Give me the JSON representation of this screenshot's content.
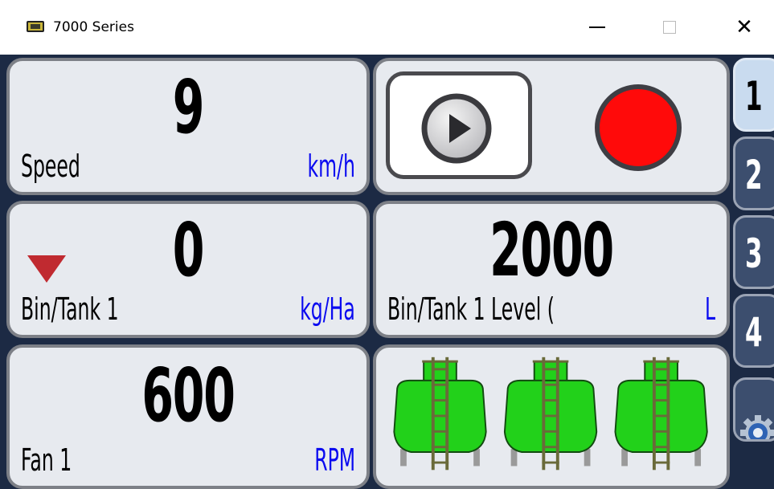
{
  "window": {
    "title": "7000 Series",
    "close_glyph": "✕"
  },
  "tiles": {
    "speed": {
      "value": "9",
      "label": "Speed",
      "unit": "km/h"
    },
    "bin_rate": {
      "value": "0",
      "label": "Bin/Tank 1",
      "unit": "kg/Ha",
      "indicator": "down-arrow-icon"
    },
    "fan": {
      "value": "600",
      "label": "Fan 1",
      "unit": "RPM"
    },
    "bin_level": {
      "value": "2000",
      "label": "Bin/Tank 1 Level (",
      "unit": "L"
    },
    "controls": {
      "play_icon": "play-icon",
      "record_icon": "record-icon"
    },
    "tanks": {
      "count": 3,
      "icon": "tank-icon",
      "fill_color": "#22d11a"
    }
  },
  "side_tabs": [
    {
      "label": "1",
      "active": true
    },
    {
      "label": "2",
      "active": false
    },
    {
      "label": "3",
      "active": false
    },
    {
      "label": "4",
      "active": false
    }
  ],
  "settings_icon": "gear-icon",
  "colors": {
    "background": "#1c2a44",
    "tile": "#e7eaef",
    "unit_text": "#0a0af0",
    "record": "#ff0a0a",
    "arrow": "#c02a30"
  }
}
